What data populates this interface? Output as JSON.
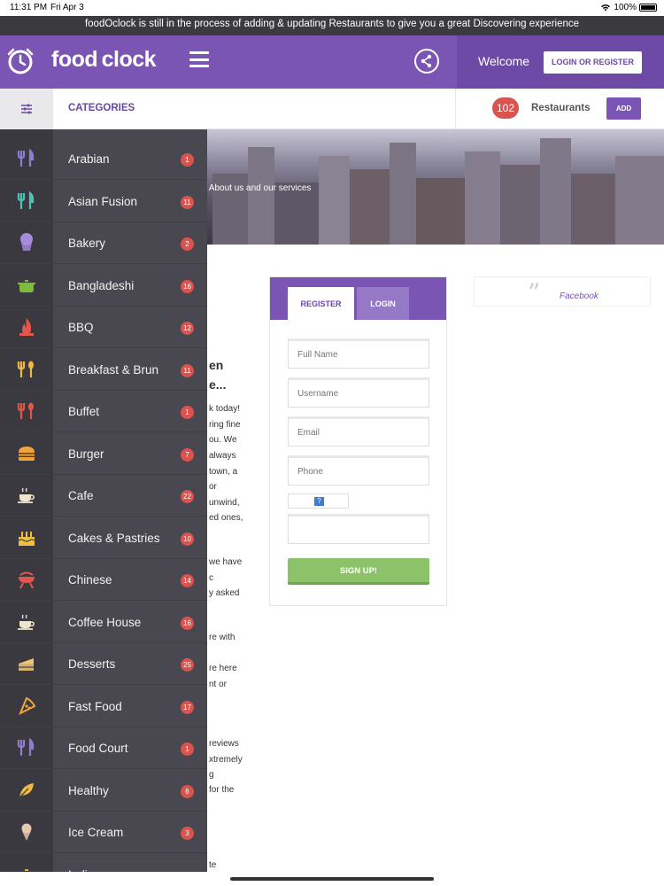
{
  "status_bar": {
    "time": "11:31 PM",
    "date": "Fri Apr 3",
    "battery": "100%"
  },
  "notice": "foodOclock is still in the process of adding & updating Restaurants to give you a great Discovering experience",
  "header": {
    "logo_text": "food clock",
    "welcome": "Welcome",
    "login_register": "LOGIN OR REGISTER"
  },
  "subheader": {
    "categories_label": "CATEGORIES",
    "restaurant_count": "102",
    "restaurants_label": "Restaurants",
    "add_label": "ADD"
  },
  "hero": {
    "text": "o About us and our services"
  },
  "content_fragments": {
    "heading": [
      "en",
      "e..."
    ],
    "lines": [
      "k today!",
      "ring fine",
      "ou. We",
      "always",
      "town, a",
      "or",
      "unwind,",
      "ed ones,",
      "we have",
      "c",
      "y asked",
      "re with",
      "re here",
      "nt or",
      "reviews",
      "xtremely",
      "g",
      "for the",
      "te"
    ]
  },
  "register_card": {
    "tab_register": "REGISTER",
    "tab_login": "LOGIN",
    "placeholders": {
      "full_name": "Full Name",
      "username": "Username",
      "email": "Email",
      "phone": "Phone"
    },
    "captcha_glyph": "?",
    "signup_label": "SIGN UP!"
  },
  "facebook_box": {
    "label": "Facebook"
  },
  "sidebar": {
    "items": [
      {
        "label": "Arabian",
        "count": "1",
        "icon": "fork-knife-icon",
        "color": "#8f7bd1"
      },
      {
        "label": "Asian Fusion",
        "count": "11",
        "icon": "fork-knife-icon",
        "color": "#4fc3b5"
      },
      {
        "label": "Bakery",
        "count": "2",
        "icon": "cupcake-icon",
        "color": "#a78bdc"
      },
      {
        "label": "Bangladeshi",
        "count": "16",
        "icon": "pot-icon",
        "color": "#7dbb3c"
      },
      {
        "label": "BBQ",
        "count": "12",
        "icon": "fire-icon",
        "color": "#e4564c"
      },
      {
        "label": "Breakfast & Brun",
        "count": "11",
        "icon": "utensils-icon",
        "color": "#f0b940"
      },
      {
        "label": "Buffet",
        "count": "1",
        "icon": "utensils-icon",
        "color": "#e4564c"
      },
      {
        "label": "Burger",
        "count": "7",
        "icon": "burger-icon",
        "color": "#f0a53c"
      },
      {
        "label": "Cafe",
        "count": "22",
        "icon": "coffee-cup-icon",
        "color": "#f1e4cf"
      },
      {
        "label": "Cakes & Pastries",
        "count": "10",
        "icon": "cake-icon",
        "color": "#f0c040"
      },
      {
        "label": "Chinese",
        "count": "14",
        "icon": "grill-icon",
        "color": "#e4564c"
      },
      {
        "label": "Coffee House",
        "count": "16",
        "icon": "coffee-cup-icon",
        "color": "#f1e4cf"
      },
      {
        "label": "Desserts",
        "count": "25",
        "icon": "cake-slice-icon",
        "color": "#f0c57a"
      },
      {
        "label": "Fast Food",
        "count": "17",
        "icon": "pizza-icon",
        "color": "#f0a53c"
      },
      {
        "label": "Food Court",
        "count": "1",
        "icon": "fork-knife-icon",
        "color": "#8f7bd1"
      },
      {
        "label": "Healthy",
        "count": "6",
        "icon": "leaf-icon",
        "color": "#f0b940"
      },
      {
        "label": "Ice Cream",
        "count": "3",
        "icon": "ice-cream-icon",
        "color": "#e8c9b0"
      },
      {
        "label": "Indian",
        "count": "",
        "icon": "pot-icon",
        "color": "#f0a53c"
      }
    ]
  },
  "colors": {
    "brand_purple": "#7a55b4",
    "badge_red": "#d9534f",
    "signup_green": "#8bc26a",
    "sidebar_bg": "#49474f"
  }
}
